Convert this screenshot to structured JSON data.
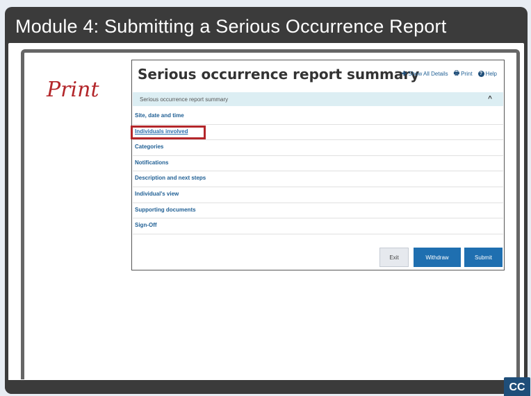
{
  "module_title": "Module 4:  Submitting a Serious Occurrence Report",
  "annotation_label": "Print",
  "app": {
    "title": "Serious occurrence report summary",
    "actions": {
      "show_all": "Show All Details",
      "print": "Print",
      "help": "Help"
    },
    "accordion_header": "Serious occurrence report summary",
    "sections": [
      "Site, date and time",
      "Individuals involved",
      "Categories",
      "Notifications",
      "Description and next steps",
      "Individual's view",
      "Supporting documents",
      "Sign-Off"
    ],
    "highlighted_section": "Individuals involved",
    "buttons": {
      "exit": "Exit",
      "withdraw": "Withdraw",
      "submit": "Submit"
    }
  },
  "player": {
    "cc_label": "CC"
  },
  "colors": {
    "frame": "#3b3b3b",
    "accent": "#1f6fb0",
    "highlight": "#b3262a",
    "accordion_bg": "#dceef3"
  }
}
